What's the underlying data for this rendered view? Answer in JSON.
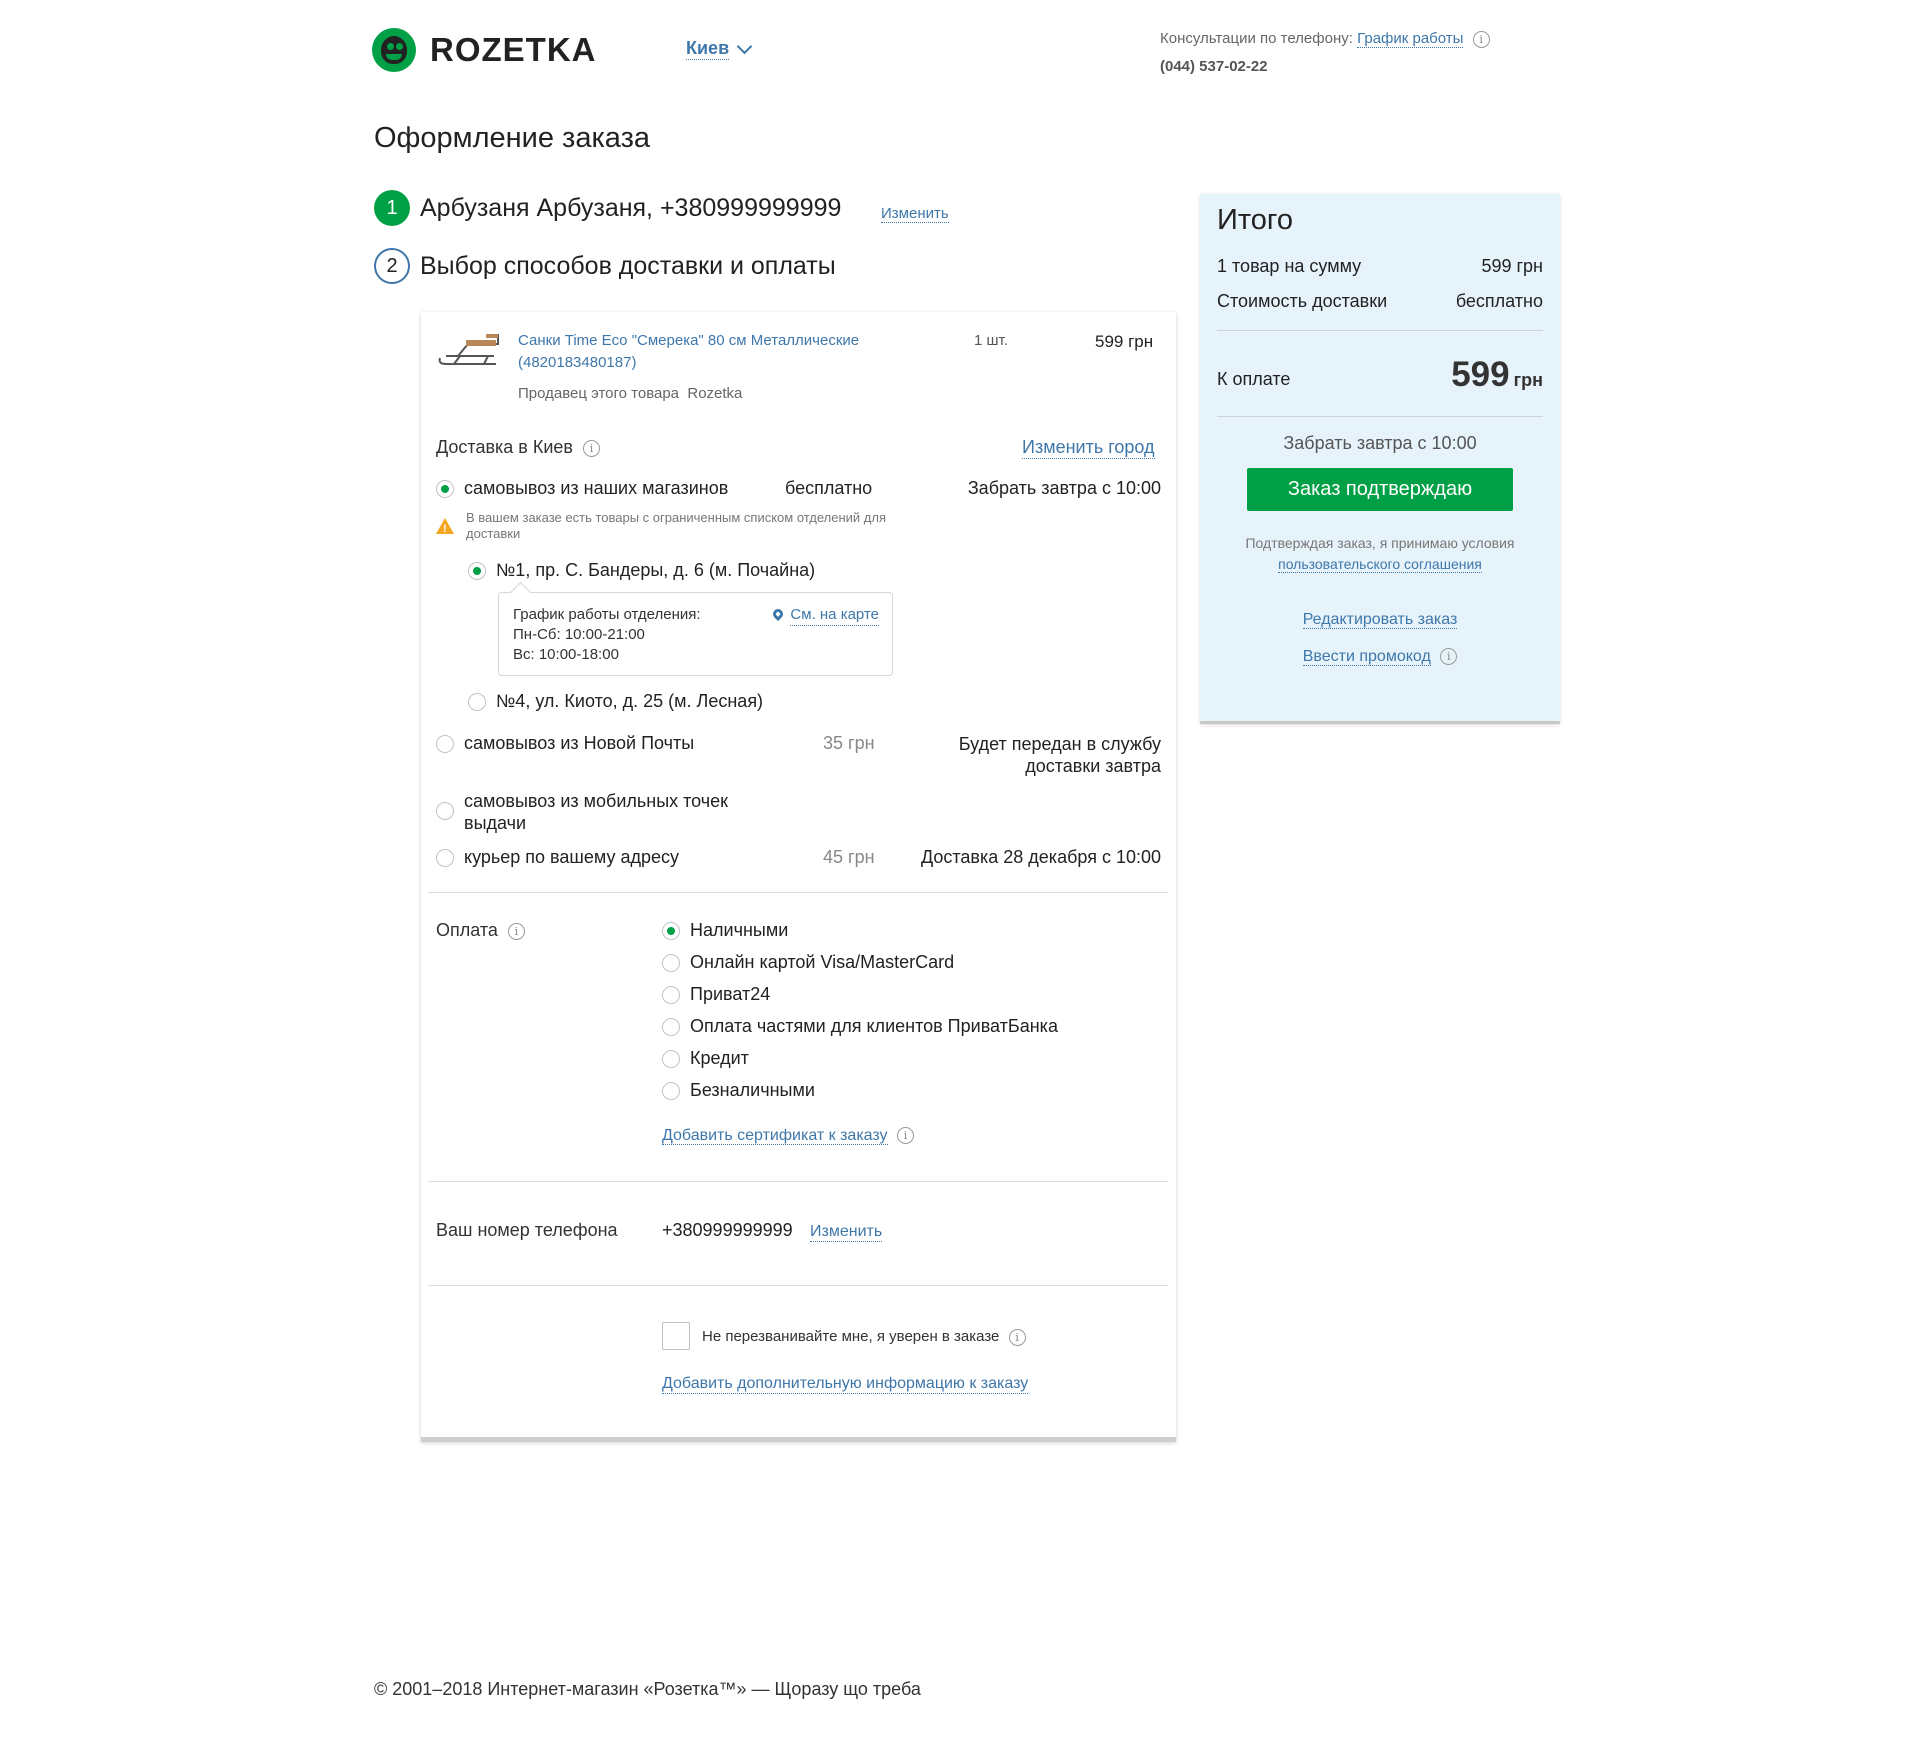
{
  "header": {
    "logo_text": "ROZETKA",
    "city": "Киев",
    "consult_label": "Консультации по телефону:",
    "schedule_link": "График работы",
    "phone": "(044) 537-02-22"
  },
  "page_title": "Оформление заказа",
  "steps": [
    {
      "num": "1",
      "text": "Арбузаня Арбузаня, +380999999999",
      "change": "Изменить"
    },
    {
      "num": "2",
      "text": "Выбор способов доставки и оплаты"
    }
  ],
  "product": {
    "title": "Санки Time Eco \"Смерека\" 80 см Металлические (4820183480187)",
    "qty": "1 шт.",
    "price": "599 грн",
    "seller_label": "Продавец этого товара",
    "seller": "Rozetka"
  },
  "delivery": {
    "heading": "Доставка в Киев",
    "change_city": "Изменить город",
    "options": [
      {
        "label": "самовывоз из наших магазинов",
        "price": "бесплатно",
        "when": "Забрать завтра с 10:00",
        "selected": true
      },
      {
        "label": "самовывоз из Новой Почты",
        "price": "35 грн",
        "when": "Будет передан в службу доставки завтра",
        "selected": false
      },
      {
        "label": "самовывоз из мобильных точек выдачи",
        "price": "",
        "when": "",
        "selected": false
      },
      {
        "label": "курьер по вашему адресу",
        "price": "45 грн",
        "when": "Доставка 28 декабря с 10:00",
        "selected": false
      }
    ],
    "warning": "В вашем заказе есть товары с ограниченным списком отделений для доставки",
    "stores": [
      {
        "label": "№1, пр. С. Бандеры, д. 6 (м. Почайна)",
        "selected": true
      },
      {
        "label": "№4, ул. Киото, д. 25 (м. Лесная)",
        "selected": false
      }
    ],
    "hours": {
      "title": "График работы отделения:",
      "weekdays": "Пн-Сб: 10:00-21:00",
      "sunday": "Вс: 10:00-18:00",
      "map_link": "См. на карте"
    }
  },
  "payment": {
    "label": "Оплата",
    "options": [
      {
        "label": "Наличными",
        "selected": true
      },
      {
        "label": "Онлайн картой Visa/MasterCard",
        "selected": false
      },
      {
        "label": "Приват24",
        "selected": false
      },
      {
        "label": "Оплата частями для клиентов ПриватБанка",
        "selected": false
      },
      {
        "label": "Кредит",
        "selected": false
      },
      {
        "label": "Безналичными",
        "selected": false
      }
    ],
    "add_certificate": "Добавить сертификат к заказу"
  },
  "contact": {
    "phone_label": "Ваш номер телефона",
    "phone_value": "+380999999999",
    "change": "Изменить",
    "no_call": "Не перезванивайте мне, я уверен в заказе",
    "add_info": "Добавить дополнительную информацию к заказу"
  },
  "summary": {
    "title": "Итого",
    "items_label": "1 товар на сумму",
    "items_value": "599 грн",
    "delivery_label": "Стоимость доставки",
    "delivery_value": "бесплатно",
    "total_label": "К оплате",
    "total_value": "599",
    "total_currency": "грн",
    "pickup_note": "Забрать завтра с 10:00",
    "confirm": "Заказ подтверждаю",
    "agree_text": "Подтверждая заказ, я принимаю условия",
    "agree_link": "пользовательского соглашения",
    "edit_order": "Редактировать заказ",
    "promo": "Ввести промокод"
  },
  "footer": "© 2001–2018 Интернет-магазин «Розетка™» — Щоразу що треба",
  "colors": {
    "brand_green": "#00a046",
    "link_blue": "#3e77aa",
    "summary_bg": "#e7f3fb"
  }
}
